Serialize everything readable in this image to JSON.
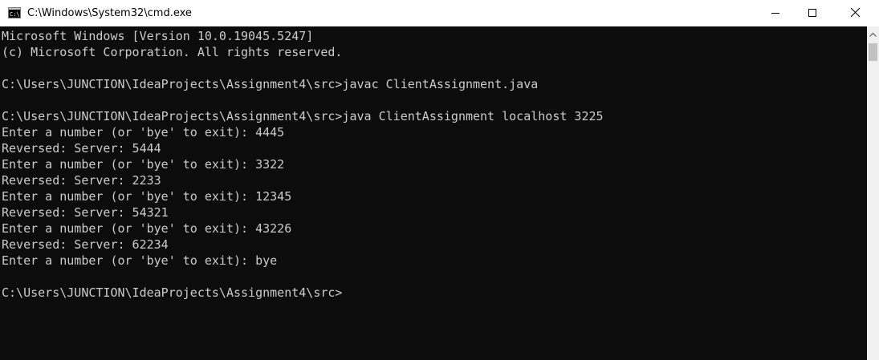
{
  "window": {
    "title": "C:\\Windows\\System32\\cmd.exe",
    "icon": "cmd-app-icon",
    "controls": [
      "minimize-icon",
      "maximize-icon",
      "close-icon"
    ]
  },
  "console": {
    "lines": [
      "Microsoft Windows [Version 10.0.19045.5247]",
      "(c) Microsoft Corporation. All rights reserved.",
      "",
      "C:\\Users\\JUNCTION\\IdeaProjects\\Assignment4\\src>javac ClientAssignment.java",
      "",
      "C:\\Users\\JUNCTION\\IdeaProjects\\Assignment4\\src>java ClientAssignment localhost 3225",
      "Enter a number (or 'bye' to exit): 4445",
      "Reversed: Server: 5444",
      "Enter a number (or 'bye' to exit): 3322",
      "Reversed: Server: 2233",
      "Enter a number (or 'bye' to exit): 12345",
      "Reversed: Server: 54321",
      "Enter a number (or 'bye' to exit): 43226",
      "Reversed: Server: 62234",
      "Enter a number (or 'bye' to exit): bye",
      "",
      "C:\\Users\\JUNCTION\\IdeaProjects\\Assignment4\\src>"
    ]
  },
  "colors": {
    "console_bg": "#0c0c0c",
    "console_text": "#cccccc",
    "titlebar_bg": "#ffffff"
  }
}
